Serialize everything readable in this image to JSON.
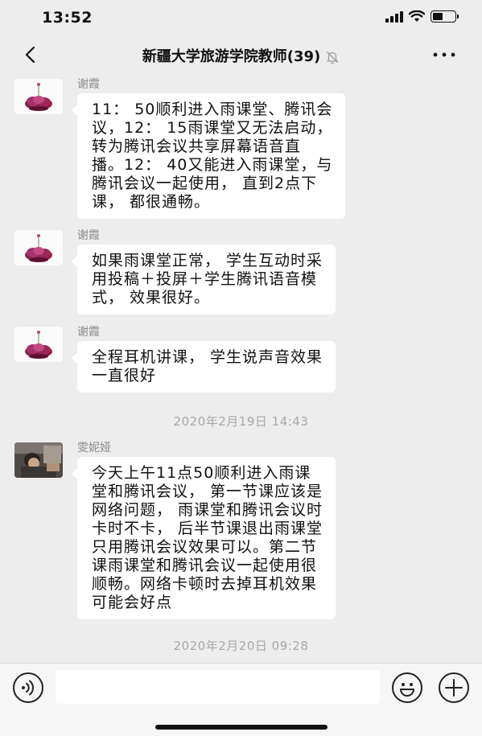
{
  "status_bar": {
    "time": "13:52",
    "battery_level": 0.45,
    "icons": [
      "signal-icon",
      "wifi-icon",
      "battery-icon"
    ]
  },
  "nav": {
    "title": "新疆大学旅游学院教师(39)",
    "back_icon": "chevron-left-icon",
    "mute_icon": "bell-off-icon",
    "more_icon": "ellipsis-icon"
  },
  "messages": [
    {
      "sender": "谢霞",
      "avatar": "flower-avatar",
      "lines": [
        "11： 50顺利进入雨课堂、腾讯会",
        "议，12： 15雨课堂又无法启动，",
        "转为腾讯会议共享屏幕语音直",
        "播。12： 40又能进入雨课堂，与",
        "腾讯会议一起使用， 直到2点下",
        "课， 都很通畅。"
      ]
    },
    {
      "sender": "谢霞",
      "avatar": "flower-avatar",
      "lines": [
        "如果雨课堂正常， 学生互动时采",
        "用投稿＋投屏＋学生腾讯语音模",
        "式， 效果很好。"
      ]
    },
    {
      "sender": "谢霞",
      "avatar": "flower-avatar",
      "lines": [
        "全程耳机讲课， 学生说声音效果",
        "一直很好"
      ]
    },
    {
      "sender": "雯妮娅",
      "avatar": "photo-avatar",
      "lines": [
        "今天上午11点50顺利进入雨课",
        "堂和腾讯会议， 第一节课应该是",
        "网络问题， 雨课堂和腾讯会议时",
        "卡时不卡， 后半节课退出雨课堂",
        "只用腾讯会议效果可以。第二节",
        "课雨课堂和腾讯会议一起使用很",
        "顺畅。网络卡顿时去掉耳机效果",
        "可能会好点"
      ]
    }
  ],
  "timestamps": [
    "2020年2月19日 14:43",
    "2020年2月20日 09:28"
  ],
  "input_bar": {
    "placeholder": "",
    "voice_icon": "voice-icon",
    "emoji_icon": "emoji-icon",
    "plus_icon": "plus-icon"
  },
  "colors": {
    "background": "#ededed",
    "bubble": "#ffffff",
    "sender_text": "#8a8a8a",
    "timestamp_text": "#a8a8a8",
    "input_bar": "#f6f6f6"
  }
}
